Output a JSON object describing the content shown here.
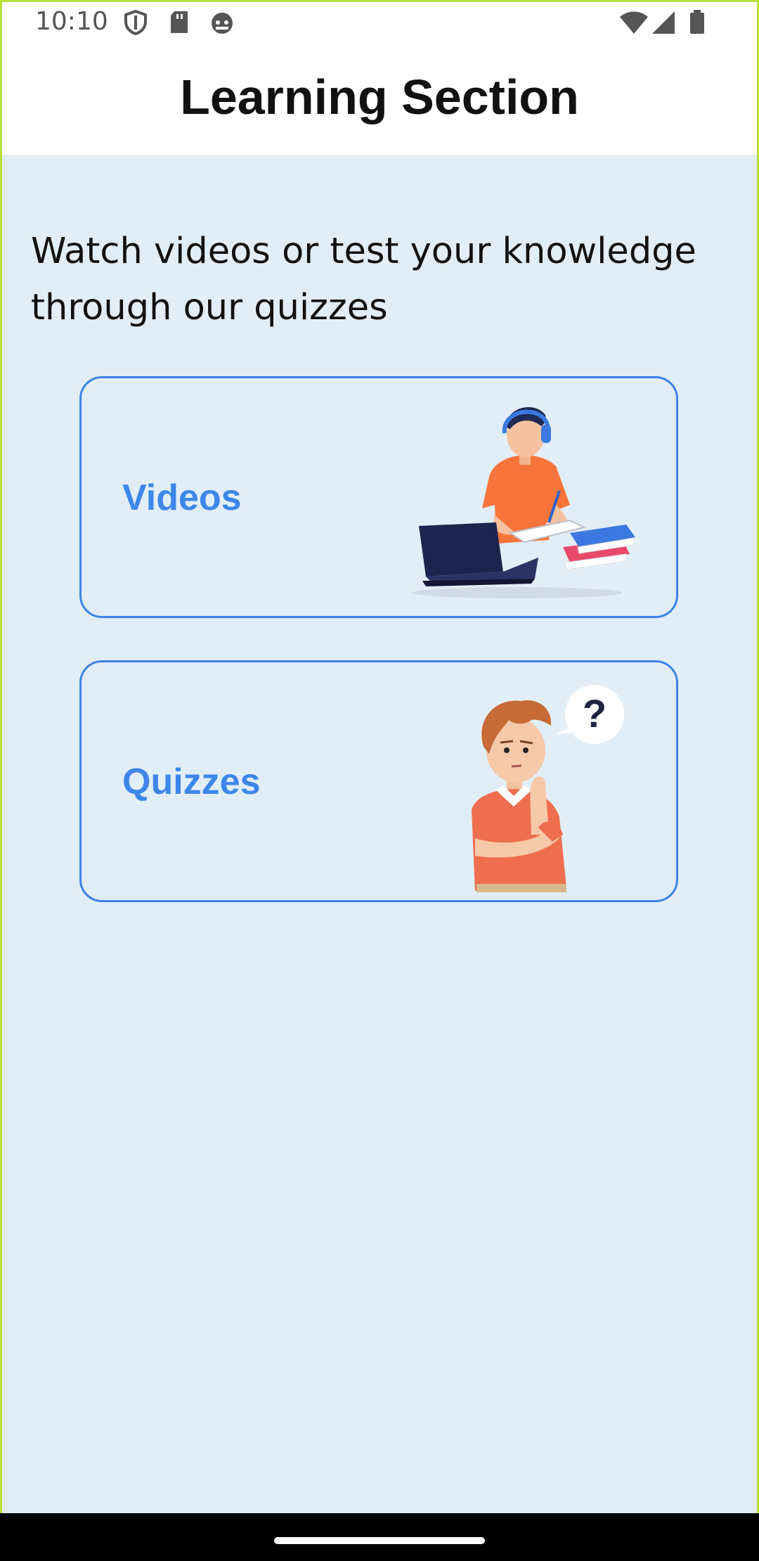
{
  "status_bar": {
    "time": "10:10",
    "left_icons": [
      "shield-icon",
      "sd-card-icon",
      "android-debug-icon"
    ],
    "right_icons": [
      "wifi-icon",
      "signal-icon",
      "battery-icon"
    ]
  },
  "header": {
    "title": "Learning Section"
  },
  "intro": {
    "text": "Watch videos or test your knowledge through our quizzes"
  },
  "cards": [
    {
      "label": "Videos",
      "illustration": "student-laptop-illustration"
    },
    {
      "label": "Quizzes",
      "illustration": "thinking-boy-illustration"
    }
  ],
  "colors": {
    "accent": "#3d82e8",
    "background": "#e2eef7",
    "frame": "#b8e03a"
  }
}
